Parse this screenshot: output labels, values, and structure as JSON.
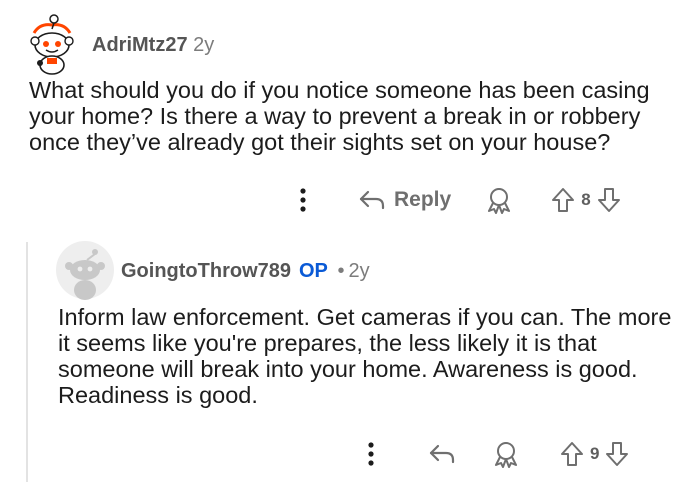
{
  "comments": [
    {
      "username": "AdriMtz27",
      "time": "2y",
      "body": "What should you do if you notice someone has been casing your home? Is there a way to prevent a break in or robbery once they’ve already got their sights set on your house?",
      "reply_label": "Reply",
      "score": "8"
    },
    {
      "username": "GoingtoThrow789",
      "badge": "OP",
      "separator": "•",
      "time": "2y",
      "body": "Inform law enforcement. Get cameras if you can. The more it seems like you're prepares, the less likely it is that someone will break into your home. Awareness is good. Readiness is good.",
      "score": "9"
    }
  ],
  "colors": {
    "op_badge": "#0a5ad6",
    "icon_gray": "#6f6f6f",
    "avatar_1_bg": "#ffffff",
    "avatar_2_bg": "#eeeeee",
    "snoo_orange": "#ff4500"
  },
  "icons": {
    "more": "more-options-icon",
    "reply": "reply-arrow-icon",
    "award": "award-icon",
    "upvote": "upvote-icon",
    "downvote": "downvote-icon"
  }
}
